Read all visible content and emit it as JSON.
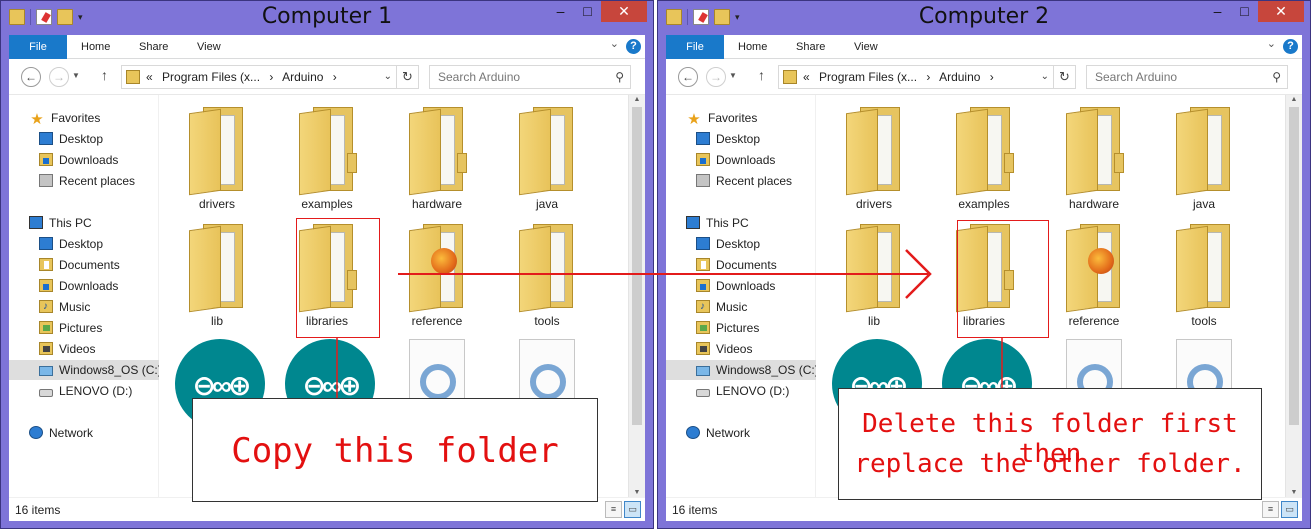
{
  "windows": [
    {
      "title": "Computer 1",
      "ribbon": {
        "file": "File",
        "home": "Home",
        "share": "Share",
        "view": "View"
      },
      "address": {
        "prefix": "«",
        "crumbs": [
          "Program Files (x...",
          "Arduino"
        ],
        "sep": "›"
      },
      "search_placeholder": "Search Arduino",
      "nav": {
        "favorites": "Favorites",
        "desktop": "Desktop",
        "downloads": "Downloads",
        "recent": "Recent places",
        "this_pc": "This PC",
        "pc_desktop": "Desktop",
        "documents": "Documents",
        "pc_downloads": "Downloads",
        "music": "Music",
        "pictures": "Pictures",
        "videos": "Videos",
        "drive_c": "Windows8_OS (C:)",
        "drive_d": "LENOVO (D:)",
        "network": "Network"
      },
      "files": [
        "drivers",
        "examples",
        "hardware",
        "java",
        "lib",
        "libraries",
        "reference",
        "tools"
      ],
      "status": "16 items",
      "callout": [
        "Copy this folder"
      ]
    },
    {
      "title": "Computer 2",
      "ribbon": {
        "file": "File",
        "home": "Home",
        "share": "Share",
        "view": "View"
      },
      "address": {
        "prefix": "«",
        "crumbs": [
          "Program Files (x...",
          "Arduino"
        ],
        "sep": "›"
      },
      "search_placeholder": "Search Arduino",
      "nav": {
        "favorites": "Favorites",
        "desktop": "Desktop",
        "downloads": "Downloads",
        "recent": "Recent places",
        "this_pc": "This PC",
        "pc_desktop": "Desktop",
        "documents": "Documents",
        "pc_downloads": "Downloads",
        "music": "Music",
        "pictures": "Pictures",
        "videos": "Videos",
        "drive_c": "Windows8_OS (C:)",
        "drive_d": "LENOVO (D:)",
        "network": "Network"
      },
      "files": [
        "drivers",
        "examples",
        "hardware",
        "java",
        "lib",
        "libraries",
        "reference",
        "tools"
      ],
      "status": "16 items",
      "callout": [
        "Delete this folder first then",
        "replace the other folder."
      ]
    }
  ],
  "colors": {
    "window_frame": "#7e74d8",
    "file_tab": "#1979ca",
    "close_button": "#c7463c",
    "annotation_red": "#e31b1b",
    "arduino_teal": "#00878f"
  },
  "icons": {
    "nav_back": "back-arrow-icon",
    "nav_forward": "forward-arrow-icon",
    "up": "up-arrow-icon",
    "refresh": "refresh-icon",
    "search": "search-icon",
    "help": "help-icon"
  }
}
